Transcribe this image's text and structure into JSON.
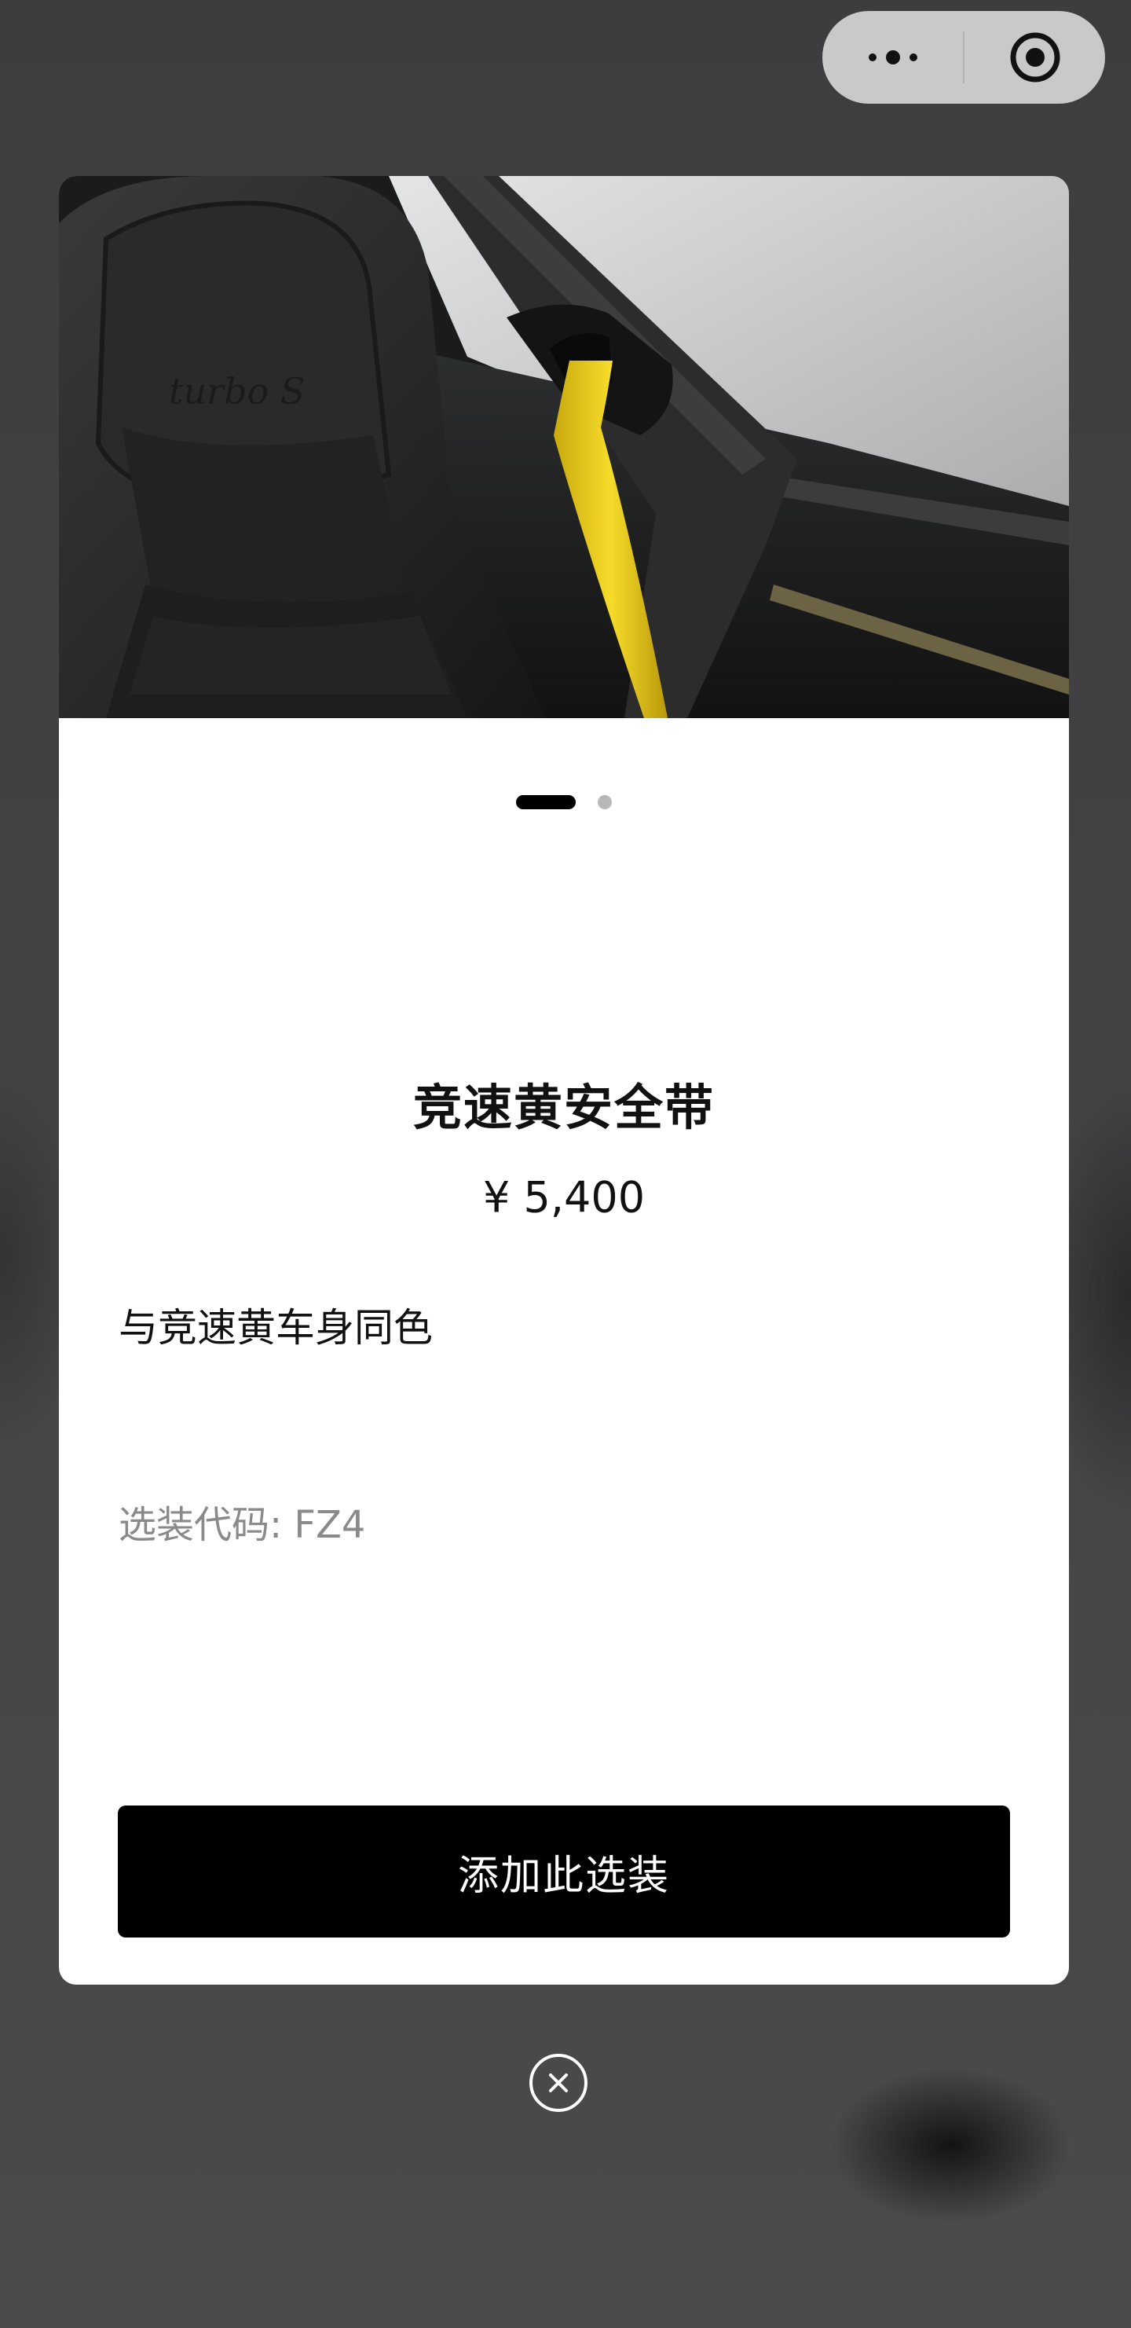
{
  "capsule": {
    "more_icon": "more-dots-icon",
    "close_icon": "target-circle-icon"
  },
  "modal": {
    "image_alt_icon": "seat-belt-photo",
    "pagination": {
      "total": 2,
      "current": 1
    },
    "title": "竞速黄安全带",
    "price": "¥ 5,400",
    "description": "与竞速黄车身同色",
    "option_code": "选装代码: FZ4",
    "add_button_label": "添加此选装"
  },
  "close_icon": "close-circle-icon",
  "colors": {
    "belt_yellow": "#f2d21c",
    "button_bg": "#000000",
    "card_bg": "#ffffff"
  }
}
